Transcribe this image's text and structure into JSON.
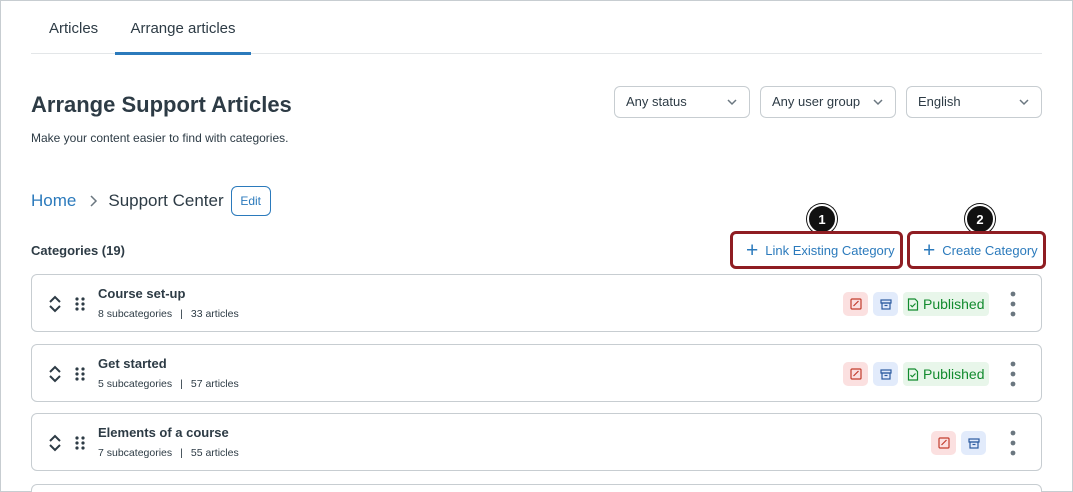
{
  "tabs": [
    {
      "label": "Articles",
      "active": false
    },
    {
      "label": "Arrange articles",
      "active": true
    }
  ],
  "header": {
    "title": "Arrange Support Articles",
    "subtitle": "Make your content easier to find with categories."
  },
  "filters": {
    "status": "Any status",
    "user_group": "Any user group",
    "language": "English"
  },
  "breadcrumb": {
    "home": "Home",
    "current": "Support Center",
    "edit_label": "Edit"
  },
  "categories_header": {
    "count_label": "Categories (19)",
    "link_existing_label": "Link Existing Category",
    "create_label": "Create Category",
    "callout_1": "1",
    "callout_2": "2"
  },
  "categories": [
    {
      "title": "Course set-up",
      "subcategories": "8 subcategories",
      "articles": "33 articles",
      "status": "Published"
    },
    {
      "title": "Get started",
      "subcategories": "5 subcategories",
      "articles": "57 articles",
      "status": "Published"
    },
    {
      "title": "Elements of a course",
      "subcategories": "7 subcategories",
      "articles": "55 articles",
      "status": ""
    }
  ],
  "colors": {
    "accent": "#2b7abc",
    "highlight_border": "#8f1d22",
    "published_text": "#128b2e",
    "published_bg": "#e8f6ea",
    "draft_badge_bg": "#fbe0e0",
    "archive_badge_bg": "#e2ebfb"
  },
  "icons": {
    "expand": "chevron-up-down-icon",
    "drag": "drag-handle-icon",
    "draft": "edit-document-icon",
    "archive": "archive-box-icon",
    "published": "document-check-icon",
    "more": "kebab-menu-icon",
    "separator": "chevron-right-icon",
    "select": "chevron-down-icon",
    "add": "plus-icon"
  }
}
